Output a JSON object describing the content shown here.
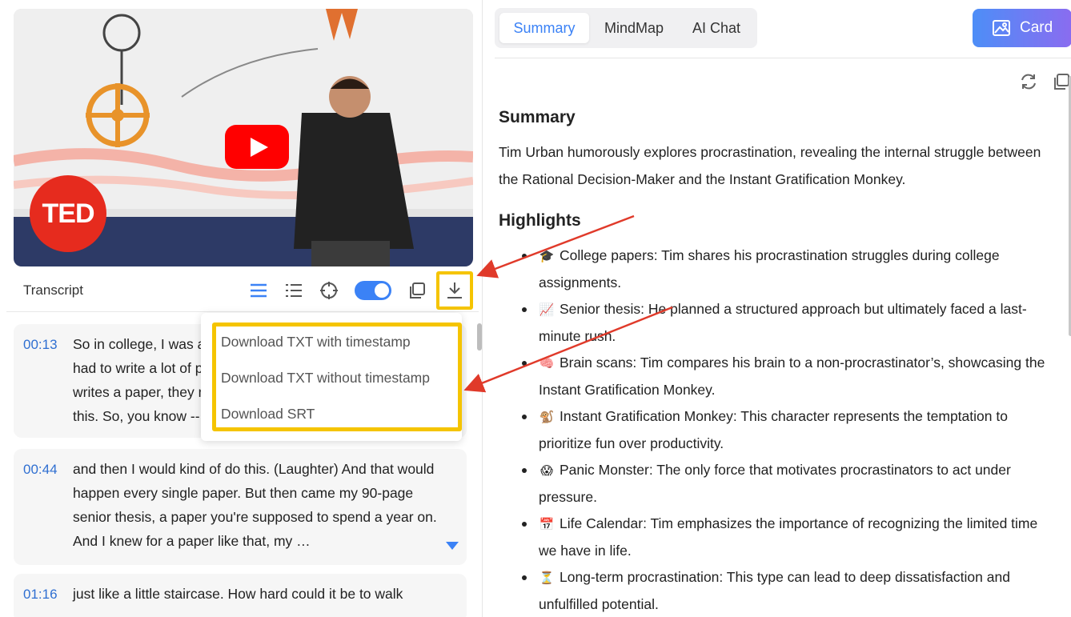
{
  "video": {
    "logo_text": "TED"
  },
  "transcript": {
    "title": "Transcript",
    "segments": [
      {
        "time": "00:13",
        "text": "So in college, I was a government major, which means I had to write a lot of papers. Now, when a normal student writes a paper, they might spread the work out a little like this. So, you know --"
      },
      {
        "time": "00:44",
        "text": "and then I would kind of do this. (Laughter) And that would happen every single paper. But then came my 90-page senior thesis, a paper you're supposed to spend a year on. And I knew for a paper like that, my …"
      },
      {
        "time": "01:16",
        "text": "just like a little staircase. How hard could it be to walk"
      }
    ]
  },
  "download_menu": {
    "items": [
      "Download TXT with timestamp",
      "Download TXT without timestamp",
      "Download SRT"
    ]
  },
  "tabs": [
    "Summary",
    "MindMap",
    "AI Chat"
  ],
  "card_button": "Card",
  "summary": {
    "heading": "Summary",
    "text": "Tim Urban humorously explores procrastination, revealing the internal struggle between the Rational Decision-Maker and the Instant Gratification Monkey."
  },
  "highlights": {
    "heading": "Highlights",
    "items": [
      {
        "emoji": "🎓",
        "text": "College papers: Tim shares his procrastination struggles during college assignments."
      },
      {
        "emoji": "📈",
        "text": "Senior thesis: He planned a structured approach but ultimately faced a last-minute rush."
      },
      {
        "emoji": "🧠",
        "text": "Brain scans: Tim compares his brain to a non-procrastinator’s, showcasing the Instant Gratification Monkey."
      },
      {
        "emoji": "🐒",
        "text": "Instant Gratification Monkey: This character represents the temptation to prioritize fun over productivity."
      },
      {
        "emoji": "😱",
        "text": "Panic Monster: The only force that motivates procrastinators to act under pressure."
      },
      {
        "emoji": "📅",
        "text": "Life Calendar: Tim emphasizes the importance of recognizing the limited time we have in life."
      },
      {
        "emoji": "⏳",
        "text": "Long-term procrastination: This type can lead to deep dissatisfaction and unfulfilled potential."
      }
    ]
  },
  "colors": {
    "accent": "#3b82f6",
    "highlight_box": "#f5c400",
    "arrow": "#e03a2a",
    "ted_red": "#e62b1e",
    "timestamp": "#2f6fd1"
  }
}
